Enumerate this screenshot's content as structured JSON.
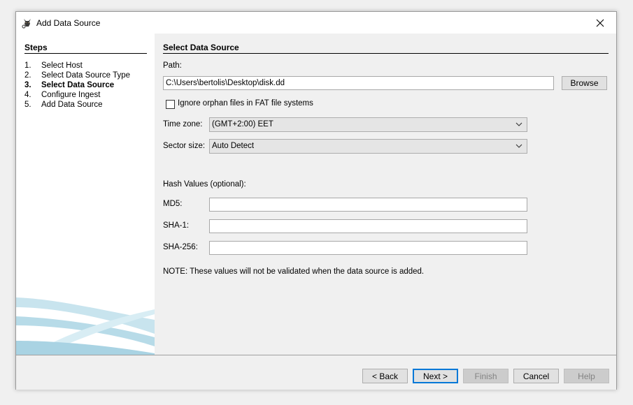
{
  "window": {
    "title": "Add Data Source",
    "icon": "autopsy-dog-icon",
    "close_icon": "close-icon"
  },
  "steps": {
    "title": "Steps",
    "items": [
      {
        "num": "1.",
        "label": "Select Host"
      },
      {
        "num": "2.",
        "label": "Select Data Source Type"
      },
      {
        "num": "3.",
        "label": "Select Data Source"
      },
      {
        "num": "4.",
        "label": "Configure Ingest"
      },
      {
        "num": "5.",
        "label": "Add Data Source"
      }
    ],
    "active_index": 2
  },
  "form": {
    "section_title": "Select Data Source",
    "path_label": "Path:",
    "path_value": "C:\\Users\\bertolis\\Desktop\\disk.dd",
    "browse_label": "Browse",
    "ignore_orphan_label": "Ignore orphan files in FAT file systems",
    "ignore_orphan_checked": false,
    "timezone_label": "Time zone:",
    "timezone_value": "(GMT+2:00) EET",
    "sector_label": "Sector size:",
    "sector_value": "Auto Detect",
    "hash_heading": "Hash Values (optional):",
    "md5_label": "MD5:",
    "md5_value": "",
    "sha1_label": "SHA-1:",
    "sha1_value": "",
    "sha256_label": "SHA-256:",
    "sha256_value": "",
    "note": "NOTE: These values will not be validated when the data source is added."
  },
  "buttons": {
    "back": "< Back",
    "next": "Next >",
    "finish": "Finish",
    "cancel": "Cancel",
    "help": "Help"
  },
  "colors": {
    "dialog_bg": "#f0f0f0",
    "panel_bg": "#ffffff",
    "focus_blue": "#0078d7",
    "swoosh": "#a9d3e3"
  }
}
